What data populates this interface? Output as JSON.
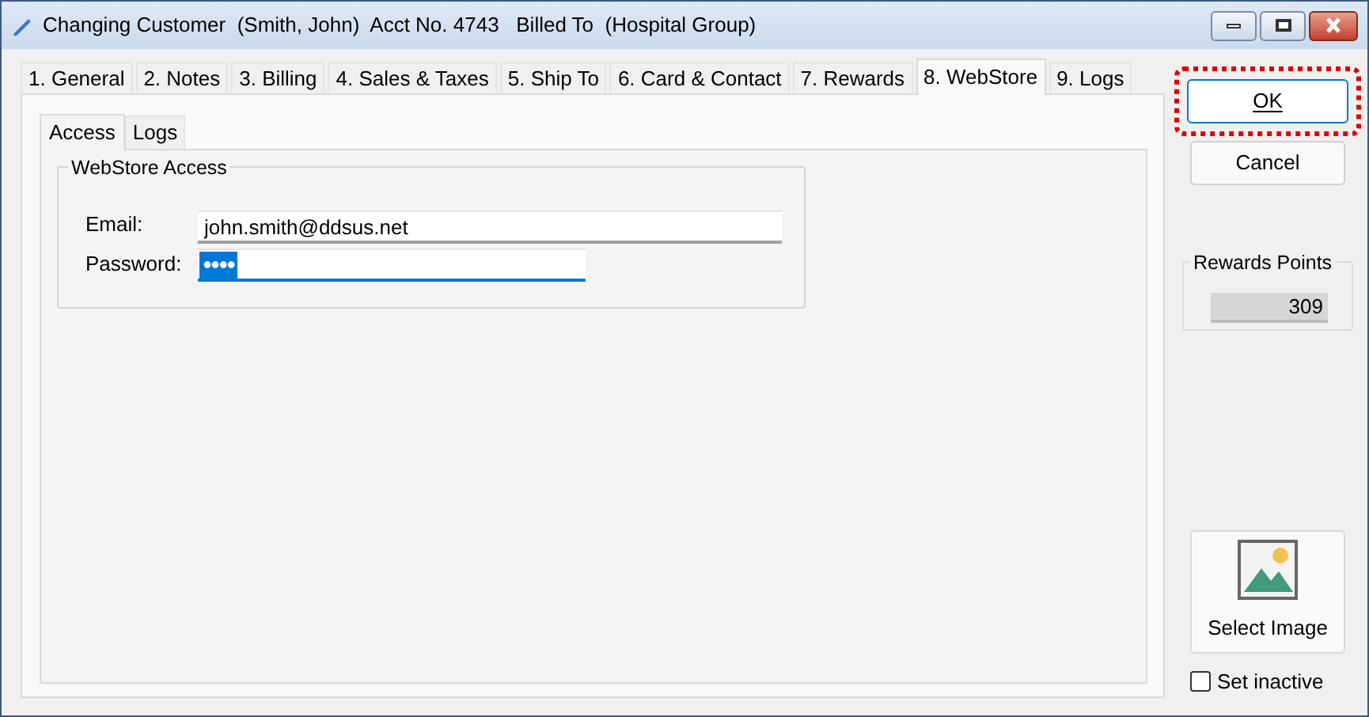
{
  "window": {
    "title": "Changing Customer  (Smith, John)  Acct No. 4743   Billed To  (Hospital Group)"
  },
  "tabs": [
    {
      "label": "1. General",
      "selected": false
    },
    {
      "label": "2. Notes",
      "selected": false
    },
    {
      "label": "3. Billing",
      "selected": false
    },
    {
      "label": "4. Sales & Taxes",
      "selected": false
    },
    {
      "label": "5. Ship To",
      "selected": false
    },
    {
      "label": "6. Card & Contact",
      "selected": false
    },
    {
      "label": "7. Rewards",
      "selected": false
    },
    {
      "label": "8. WebStore",
      "selected": true
    },
    {
      "label": "9. Logs",
      "selected": false
    }
  ],
  "subtabs": [
    {
      "label": "Access",
      "selected": true
    },
    {
      "label": "Logs",
      "selected": false
    }
  ],
  "webstore_access": {
    "title": "WebStore Access",
    "email": {
      "label": "Email:",
      "value": "john.smith@ddsus.net"
    },
    "password": {
      "label": "Password:",
      "value": "●●●●",
      "focused": true
    }
  },
  "buttons": {
    "ok": "OK",
    "cancel": "Cancel"
  },
  "rewards_points": {
    "title": "Rewards Points",
    "value": "309"
  },
  "select_image": "Select Image",
  "set_inactive": {
    "label": "Set inactive",
    "checked": false
  }
}
